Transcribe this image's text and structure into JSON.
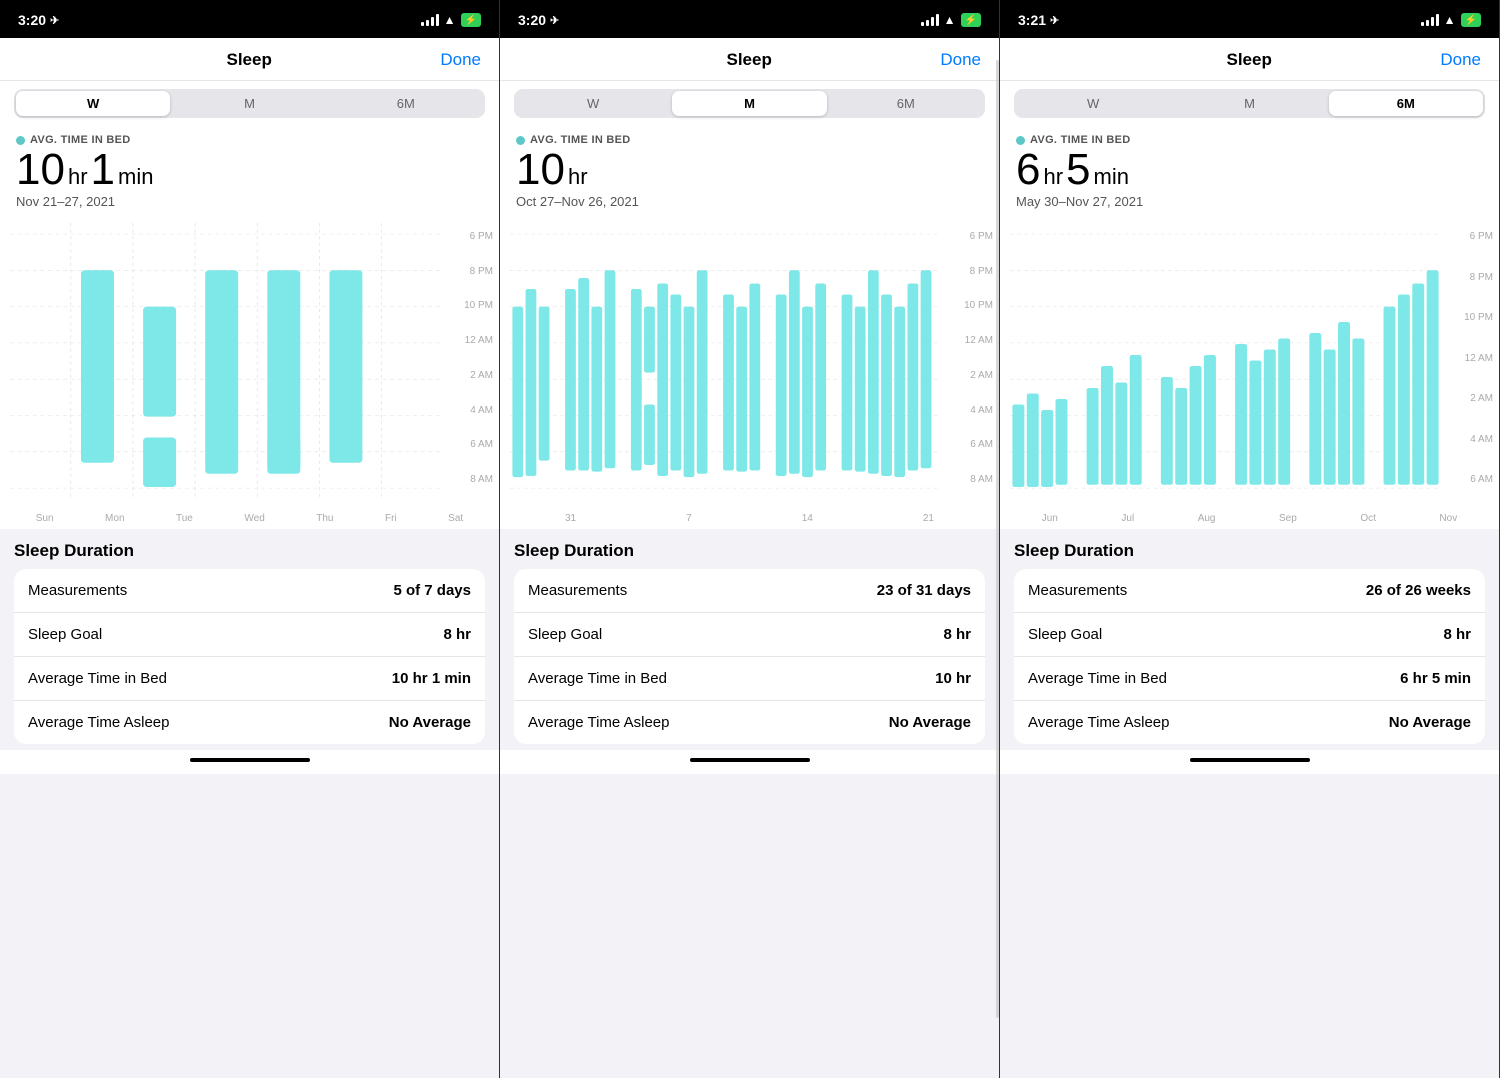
{
  "panels": [
    {
      "id": "panel-week",
      "statusBar": {
        "time": "3:20",
        "hasLocation": true
      },
      "nav": {
        "title": "Sleep",
        "doneLabel": "Done"
      },
      "segments": {
        "options": [
          "W",
          "M",
          "6M"
        ],
        "active": "W"
      },
      "stats": {
        "avgLabel": "AVG. TIME IN BED",
        "bigHr": "10",
        "bigHrUnit": "hr",
        "bigMin": "1",
        "bigMinUnit": "min",
        "dateRange": "Nov 21–27, 2021"
      },
      "chartYLabels": [
        "6 PM",
        "8 PM",
        "10 PM",
        "12 AM",
        "2 AM",
        "4 AM",
        "6 AM",
        "8 AM"
      ],
      "chartXLabels": [
        "Sun",
        "Mon",
        "Tue",
        "Wed",
        "Thu",
        "Fri",
        "Sat"
      ],
      "sleepDuration": {
        "title": "Sleep Duration",
        "rows": [
          {
            "label": "Measurements",
            "value": "5 of 7 days"
          },
          {
            "label": "Sleep Goal",
            "value": "8 hr"
          },
          {
            "label": "Average Time in Bed",
            "value": "10 hr 1 min"
          },
          {
            "label": "Average Time Asleep",
            "value": "No Average"
          }
        ]
      }
    },
    {
      "id": "panel-month",
      "statusBar": {
        "time": "3:20",
        "hasLocation": true
      },
      "nav": {
        "title": "Sleep",
        "doneLabel": "Done"
      },
      "segments": {
        "options": [
          "W",
          "M",
          "6M"
        ],
        "active": "M"
      },
      "stats": {
        "avgLabel": "AVG. TIME IN BED",
        "bigHr": "10",
        "bigHrUnit": "hr",
        "bigMin": "",
        "bigMinUnit": "",
        "dateRange": "Oct 27–Nov 26, 2021"
      },
      "chartYLabels": [
        "6 PM",
        "8 PM",
        "10 PM",
        "12 AM",
        "2 AM",
        "4 AM",
        "6 AM",
        "8 AM"
      ],
      "chartXLabels": [
        "31",
        "7",
        "14",
        "21"
      ],
      "sleepDuration": {
        "title": "Sleep Duration",
        "rows": [
          {
            "label": "Measurements",
            "value": "23 of 31 days"
          },
          {
            "label": "Sleep Goal",
            "value": "8 hr"
          },
          {
            "label": "Average Time in Bed",
            "value": "10 hr"
          },
          {
            "label": "Average Time Asleep",
            "value": "No Average"
          }
        ]
      }
    },
    {
      "id": "panel-6month",
      "statusBar": {
        "time": "3:21",
        "hasLocation": true
      },
      "nav": {
        "title": "Sleep",
        "doneLabel": "Done"
      },
      "segments": {
        "options": [
          "W",
          "M",
          "6M"
        ],
        "active": "6M"
      },
      "stats": {
        "avgLabel": "AVG. TIME IN BED",
        "bigHr": "6",
        "bigHrUnit": "hr",
        "bigMin": "5",
        "bigMinUnit": "min",
        "dateRange": "May 30–Nov 27, 2021"
      },
      "chartYLabels": [
        "6 PM",
        "8 PM",
        "10 PM",
        "12 AM",
        "2 AM",
        "4 AM",
        "6 AM"
      ],
      "chartXLabels": [
        "Jun",
        "Jul",
        "Aug",
        "Sep",
        "Oct",
        "Nov"
      ],
      "sleepDuration": {
        "title": "Sleep Duration",
        "rows": [
          {
            "label": "Measurements",
            "value": "26 of 26 weeks"
          },
          {
            "label": "Sleep Goal",
            "value": "8 hr"
          },
          {
            "label": "Average Time in Bed",
            "value": "6 hr 5 min"
          },
          {
            "label": "Average Time Asleep",
            "value": "No Average"
          }
        ]
      }
    }
  ],
  "colors": {
    "teal": "#7ee8e8",
    "blue": "#007aff",
    "black": "#000000",
    "white": "#ffffff",
    "lightGray": "#f2f2f7",
    "medGray": "#e5e5ea",
    "textGray": "#aaaaaa"
  }
}
